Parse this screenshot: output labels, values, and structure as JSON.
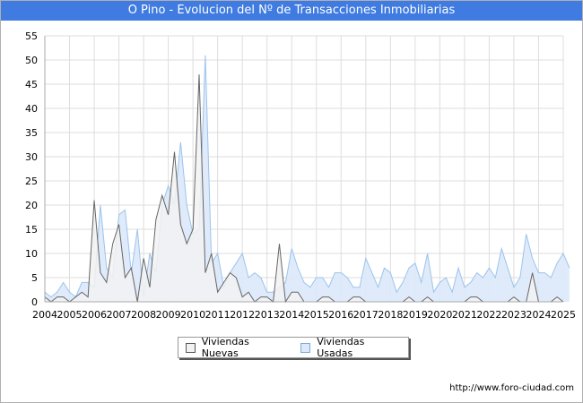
{
  "header": {
    "title": "O Pino - Evolucion del Nº de Transacciones Inmobiliarias"
  },
  "footer": {
    "url": "http://www.foro-ciudad.com"
  },
  "colors": {
    "title_bg": "#3f7be0",
    "nuevas_fill": "#f2f2f2",
    "nuevas_line": "#666666",
    "usadas_fill": "#dbe9fa",
    "usadas_line": "#9cc3ec"
  },
  "chart_data": {
    "type": "area",
    "title": "O Pino - Evolucion del Nº de Transacciones Inmobiliarias",
    "xlabel": "",
    "ylabel": "",
    "x_start": "2004-Q1",
    "period": "quarter",
    "ylim": [
      0,
      55
    ],
    "y_ticks": [
      0,
      5,
      10,
      15,
      20,
      25,
      30,
      35,
      40,
      45,
      50,
      55
    ],
    "x_tick_labels": [
      "2004",
      "2005",
      "2006",
      "2007",
      "2008",
      "2009",
      "2010",
      "2011",
      "2012",
      "2013",
      "2014",
      "2015",
      "2016",
      "2017",
      "2018",
      "2019",
      "2020",
      "2021",
      "2022",
      "2023",
      "2024",
      "2025"
    ],
    "grid": true,
    "legend_position": "bottom",
    "series": [
      {
        "name": "Viviendas Nuevas",
        "values": [
          1,
          0,
          1,
          1,
          0,
          1,
          2,
          1,
          21,
          6,
          4,
          12,
          16,
          5,
          7,
          0,
          9,
          3,
          17,
          22,
          18,
          31,
          16,
          12,
          15,
          47,
          6,
          10,
          2,
          4,
          6,
          5,
          1,
          2,
          0,
          1,
          1,
          0,
          12,
          0,
          2,
          2,
          0,
          0,
          0,
          1,
          1,
          0,
          0,
          0,
          1,
          1,
          0,
          0,
          0,
          0,
          0,
          0,
          0,
          1,
          0,
          0,
          1,
          0,
          0,
          0,
          0,
          0,
          0,
          1,
          1,
          0,
          0,
          0,
          0,
          0,
          1,
          0,
          0,
          6,
          0,
          0,
          0,
          1,
          0
        ]
      },
      {
        "name": "Viviendas Usadas",
        "values": [
          2,
          1,
          2,
          4,
          2,
          1,
          4,
          4,
          3,
          20,
          7,
          5,
          18,
          19,
          6,
          15,
          1,
          10,
          6,
          20,
          24,
          20,
          33,
          20,
          14,
          15,
          51,
          8,
          10,
          3,
          6,
          8,
          10,
          5,
          6,
          5,
          2,
          2,
          3,
          4,
          11,
          7,
          4,
          3,
          5,
          5,
          3,
          6,
          6,
          5,
          3,
          3,
          9,
          6,
          3,
          7,
          6,
          2,
          4,
          7,
          8,
          4,
          10,
          2,
          4,
          5,
          2,
          7,
          3,
          4,
          6,
          5,
          7,
          5,
          11,
          7,
          3,
          5,
          14,
          9,
          6,
          6,
          5,
          8,
          10,
          7
        ]
      }
    ]
  }
}
